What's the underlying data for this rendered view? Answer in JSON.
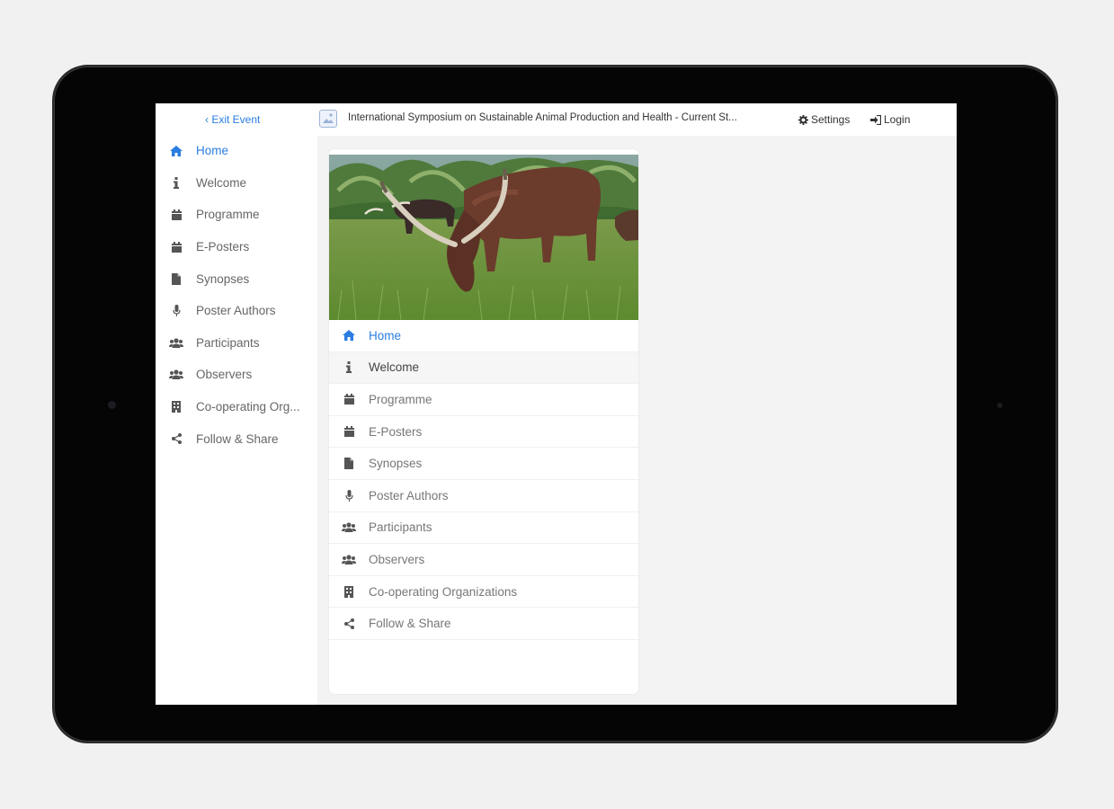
{
  "header": {
    "exit_label": "‹ Exit Event",
    "event_title": "International Symposium on Sustainable Animal Production and Health - Current St...",
    "settings_label": "Settings",
    "login_label": "Login"
  },
  "sidebar": {
    "items": [
      {
        "label": "Home",
        "icon": "home-icon"
      },
      {
        "label": "Welcome",
        "icon": "info-icon"
      },
      {
        "label": "Programme",
        "icon": "calendar-icon"
      },
      {
        "label": "E-Posters",
        "icon": "calendar-icon"
      },
      {
        "label": "Synopses",
        "icon": "document-icon"
      },
      {
        "label": "Poster Authors",
        "icon": "microphone-icon"
      },
      {
        "label": "Participants",
        "icon": "users-icon"
      },
      {
        "label": "Observers",
        "icon": "users-icon"
      },
      {
        "label": "Co-operating Org...",
        "icon": "building-icon"
      },
      {
        "label": "Follow & Share",
        "icon": "share-icon"
      }
    ]
  },
  "card": {
    "items": [
      {
        "label": "Home",
        "icon": "home-icon"
      },
      {
        "label": "Welcome",
        "icon": "info-icon"
      },
      {
        "label": "Programme",
        "icon": "calendar-icon"
      },
      {
        "label": "E-Posters",
        "icon": "calendar-icon"
      },
      {
        "label": "Synopses",
        "icon": "document-icon"
      },
      {
        "label": "Poster Authors",
        "icon": "microphone-icon"
      },
      {
        "label": "Participants",
        "icon": "users-icon"
      },
      {
        "label": "Observers",
        "icon": "users-icon"
      },
      {
        "label": "Co-operating Organizations",
        "icon": "building-icon"
      },
      {
        "label": "Follow & Share",
        "icon": "share-icon"
      }
    ]
  },
  "colors": {
    "accent": "#2a7de1",
    "text": "#666666",
    "background": "#f3f3f3"
  }
}
